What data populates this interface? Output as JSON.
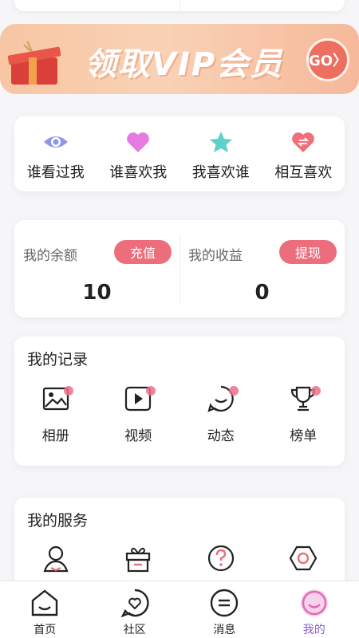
{
  "banner": {
    "text": "领取VIP会员",
    "go_label": "GO〉"
  },
  "quick_links": [
    {
      "label": "谁看过我",
      "icon": "eye-icon"
    },
    {
      "label": "谁喜欢我",
      "icon": "heart-icon"
    },
    {
      "label": "我喜欢谁",
      "icon": "star-icon"
    },
    {
      "label": "相互喜欢",
      "icon": "mutual-heart-icon"
    }
  ],
  "balance": {
    "label": "我的余额",
    "button": "充值",
    "value": "10"
  },
  "earnings": {
    "label": "我的收益",
    "button": "提现",
    "value": "0"
  },
  "records": {
    "title": "我的记录",
    "items": [
      {
        "label": "相册",
        "icon": "album-icon"
      },
      {
        "label": "视频",
        "icon": "video-icon"
      },
      {
        "label": "动态",
        "icon": "moments-icon"
      },
      {
        "label": "榜单",
        "icon": "trophy-icon"
      }
    ]
  },
  "services": {
    "title": "我的服务",
    "items": [
      {
        "icon": "profile-icon"
      },
      {
        "icon": "gift-box-icon"
      },
      {
        "icon": "help-icon"
      },
      {
        "icon": "settings-icon"
      }
    ]
  },
  "tabs": [
    {
      "label": "首页",
      "icon": "home-icon"
    },
    {
      "label": "社区",
      "icon": "community-icon"
    },
    {
      "label": "消息",
      "icon": "message-icon"
    },
    {
      "label": "我的",
      "icon": "profile-tab-icon",
      "active": true
    }
  ],
  "colors": {
    "accent": "#ec6e7c",
    "active_tab": "#8a5cd6",
    "banner": "#f7c6a3"
  }
}
